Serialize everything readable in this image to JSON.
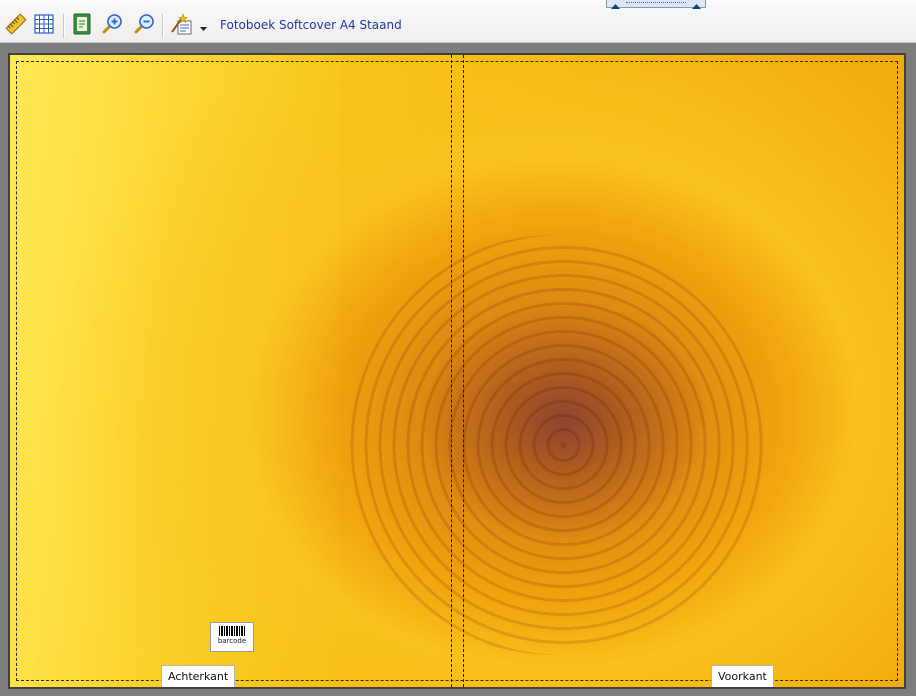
{
  "toolbar": {
    "document_title": "Fotoboek Softcover A4 Staand",
    "buttons": [
      {
        "name": "ruler-icon"
      },
      {
        "name": "grid-icon"
      },
      {
        "name": "page-view-icon"
      },
      {
        "name": "zoom-in-icon"
      },
      {
        "name": "zoom-out-icon"
      },
      {
        "name": "wizard-icon"
      }
    ]
  },
  "canvas": {
    "back_label": "Achterkant",
    "front_label": "Voorkant",
    "barcode_label": "barcode"
  },
  "colors": {
    "toolbar_bg": "#f2f2f2",
    "title_text": "#1f3a9a",
    "workspace_bg": "#7d7d7d"
  }
}
